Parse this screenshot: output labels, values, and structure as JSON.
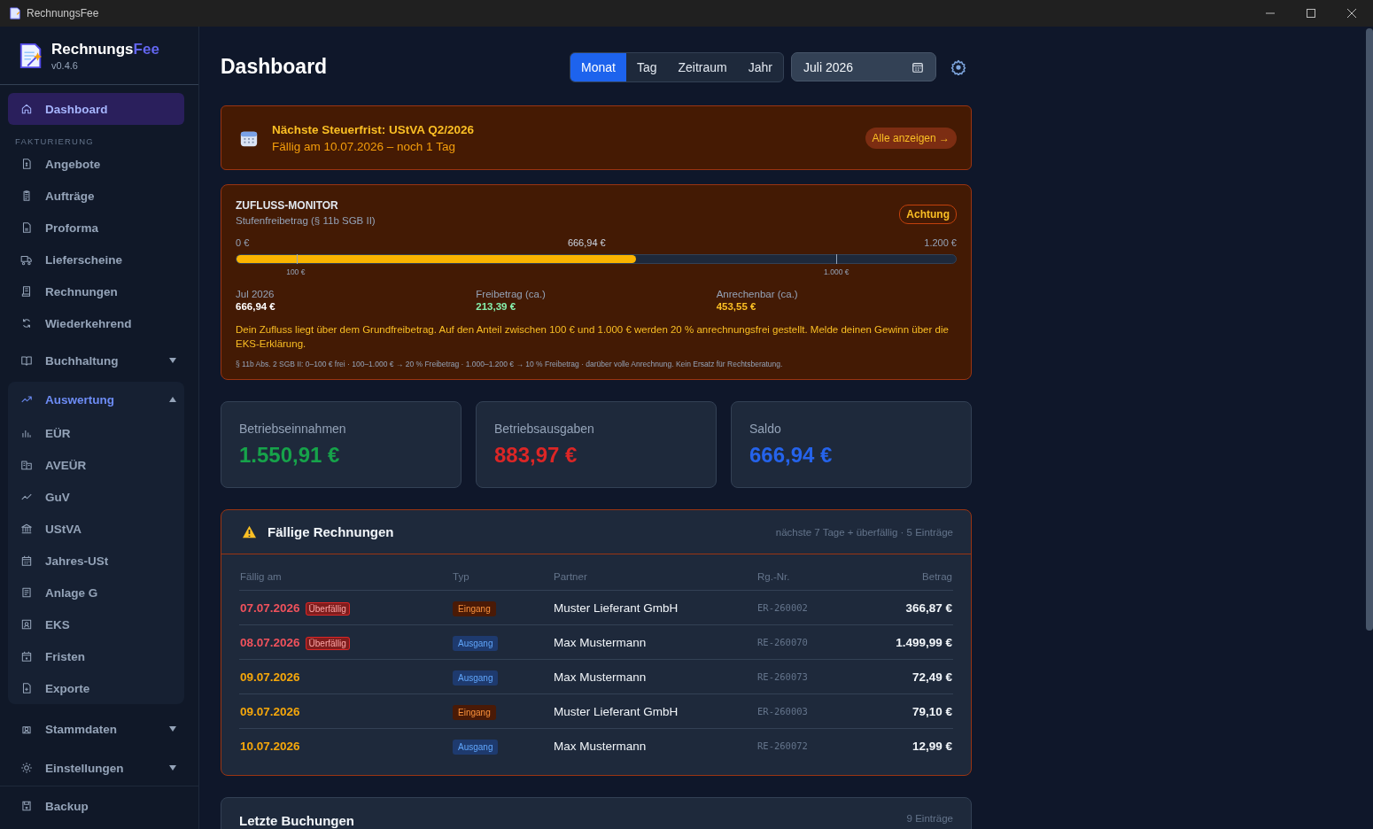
{
  "window": {
    "title": "RechnungsFee"
  },
  "sidebar": {
    "brand": "Rechnungs",
    "brand_accent": "Fee",
    "version": "v0.4.6",
    "items": [
      {
        "kind": "link",
        "label": "Dashboard",
        "selected": true
      },
      {
        "kind": "section",
        "label": "FAKTURIERUNG"
      },
      {
        "kind": "link",
        "label": "Angebote",
        "selected": false
      },
      {
        "kind": "link",
        "label": "Aufträge",
        "selected": false
      },
      {
        "kind": "link",
        "label": "Proforma",
        "selected": false
      },
      {
        "kind": "link",
        "label": "Lieferscheine",
        "selected": false
      },
      {
        "kind": "link",
        "label": "Rechnungen",
        "selected": false
      },
      {
        "kind": "link",
        "label": "Wiederkehrend",
        "selected": false
      },
      {
        "kind": "group",
        "label": "Buchhaltung",
        "expanded": false
      },
      {
        "kind": "group",
        "label": "Auswertung",
        "expanded": true,
        "children": [
          {
            "label": "EÜR",
            "selected": false
          },
          {
            "label": "AVEÜR",
            "selected": false
          },
          {
            "label": "GuV",
            "selected": false
          },
          {
            "label": "UStVA",
            "selected": false
          },
          {
            "label": "Jahres-USt",
            "selected": false
          },
          {
            "label": "Anlage G",
            "selected": false
          },
          {
            "label": "EKS",
            "selected": false
          },
          {
            "label": "Fristen",
            "selected": false
          },
          {
            "label": "Exporte",
            "selected": false
          }
        ]
      },
      {
        "kind": "group",
        "label": "Stammdaten",
        "expanded": false
      },
      {
        "kind": "group",
        "label": "Einstellungen",
        "expanded": false
      }
    ],
    "footer": "Backup"
  },
  "header": {
    "title": "Dashboard",
    "periods": [
      {
        "label": "Monat",
        "selected": true
      },
      {
        "label": "Tag",
        "selected": false
      },
      {
        "label": "Zeitraum",
        "selected": false
      },
      {
        "label": "Jahr",
        "selected": false
      }
    ],
    "date_value": "Juli 2026"
  },
  "deadline": {
    "title": "Nächste Steuerfrist: UStVA Q2/2026",
    "subtitle": "Fällig am 10.07.2026 – noch 1 Tag",
    "button": "Alle anzeigen →"
  },
  "monitor": {
    "title": "ZUFLUSS-MONITOR",
    "subtitle": "Stufenfreibetrag (§ 11b SGB II)",
    "badge": "Achtung",
    "min_label": "0 €",
    "current_label": "666,94 €",
    "max_label": "1.200 €",
    "level": 0.556,
    "ticks": [
      "100 €",
      "1.000 €"
    ],
    "stats": [
      {
        "label": "Jul 2026",
        "value": "666,94 €",
        "color": "#ffffff"
      },
      {
        "label": "Freibetrag (ca.)",
        "value": "213,39 €",
        "color": "#86efac"
      },
      {
        "label": "Anrechenbar (ca.)",
        "value": "453,55 €",
        "color": "#fbbf24"
      }
    ],
    "message": "Dein Zufluss liegt über dem Grundfreibetrag. Auf den Anteil zwischen 100 € und 1.000 € werden 20 % anrechnungsfrei gestellt. Melde deinen Gewinn über die EKS-Erklärung.",
    "footnote": "§ 11b Abs. 2 SGB II: 0–100 € frei · 100–1.000 € → 20 % Freibetrag · 1.000–1.200 € → 10 % Freibetrag · darüber volle Anrechnung. Kein Ersatz für Rechtsberatung."
  },
  "summary": [
    {
      "label": "Betriebseinnahmen",
      "value": "1.550,91 €",
      "color": "#16a34a"
    },
    {
      "label": "Betriebsausgaben",
      "value": "883,97 €",
      "color": "#dc2626"
    },
    {
      "label": "Saldo",
      "value": "666,94 €",
      "color": "#2563eb"
    }
  ],
  "due": {
    "title": "Fällige Rechnungen",
    "meta": "nächste 7 Tage + überfällig · 5 Einträge",
    "columns": [
      "Fällig am",
      "Typ",
      "Partner",
      "Rg.-Nr.",
      "Betrag"
    ],
    "rows": [
      {
        "date": "07.07.2026",
        "overdue": true,
        "badge": "Überfällig",
        "type": "Eingang",
        "kind": "in",
        "partner": "Muster Lieferant GmbH",
        "number": "ER-260002",
        "amount": "366,87 €"
      },
      {
        "date": "08.07.2026",
        "overdue": true,
        "badge": "Überfällig",
        "type": "Ausgang",
        "kind": "out",
        "partner": "Max Mustermann",
        "number": "RE-260070",
        "amount": "1.499,99 €"
      },
      {
        "date": "09.07.2026",
        "overdue": false,
        "type": "Ausgang",
        "kind": "out",
        "partner": "Max Mustermann",
        "number": "RE-260073",
        "amount": "72,49 €"
      },
      {
        "date": "09.07.2026",
        "overdue": false,
        "type": "Eingang",
        "kind": "in",
        "partner": "Muster Lieferant GmbH",
        "number": "ER-260003",
        "amount": "79,10 €"
      },
      {
        "date": "10.07.2026",
        "overdue": false,
        "type": "Ausgang",
        "kind": "out",
        "partner": "Max Mustermann",
        "number": "RE-260072",
        "amount": "12,99 €"
      }
    ]
  },
  "bookings": {
    "title": "Letzte Buchungen",
    "meta": "9 Einträge"
  }
}
